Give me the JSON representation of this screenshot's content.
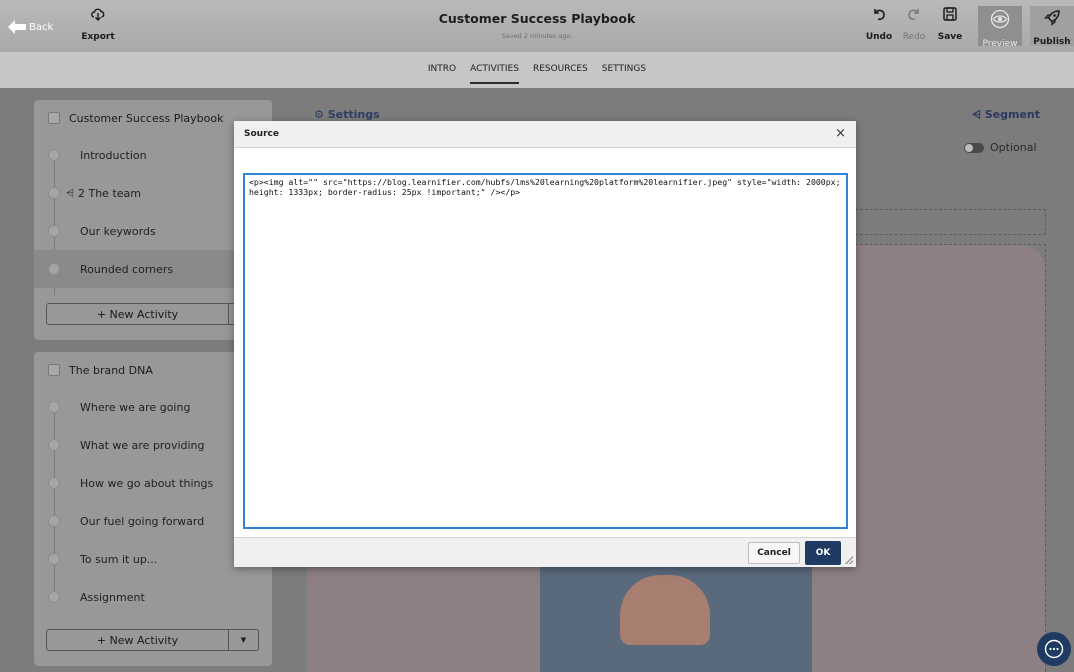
{
  "topbar": {
    "back_label": "Back",
    "export_label": "Export",
    "title": "Customer Success Playbook",
    "subtitle": "Saved 2 minutes ago.",
    "undo_label": "Undo",
    "redo_label": "Redo",
    "save_label": "Save",
    "preview_label": "Preview",
    "publish_label": "Publish"
  },
  "tabs": [
    "INTRO",
    "ACTIVITIES",
    "RESOURCES",
    "SETTINGS"
  ],
  "active_tab": "ACTIVITIES",
  "sections": [
    {
      "title": "Customer Success Playbook",
      "items": [
        {
          "label": "Introduction"
        },
        {
          "label": "2  The team",
          "segment": true
        },
        {
          "label": "Our keywords"
        },
        {
          "label": "Rounded corners",
          "selected": true
        }
      ],
      "new_activity_label": "+ New Activity"
    },
    {
      "title": "The brand DNA",
      "items": [
        {
          "label": "Where we are going"
        },
        {
          "label": "What we are providing"
        },
        {
          "label": "How we go about things"
        },
        {
          "label": "Our fuel going forward"
        },
        {
          "label": "To sum it up..."
        },
        {
          "label": "Assignment"
        }
      ],
      "new_activity_label": "+ New Activity"
    }
  ],
  "editor": {
    "settings_label": "Settings",
    "segment_label": "Segment",
    "optional_label": "Optional"
  },
  "dialog": {
    "title": "Source",
    "close_glyph": "×",
    "source_code": "<p><img alt=\"\" src=\"https://blog.learnifier.com/hubfs/lms%20learning%20platform%20learnifier.jpeg\" style=\"width: 2000px; height: 1333px; border-radius: 25px !important;\" /></p>",
    "cancel_label": "Cancel",
    "ok_label": "OK"
  },
  "colors": {
    "accent": "#1f3b63",
    "textarea_focus": "#2f86d6"
  }
}
